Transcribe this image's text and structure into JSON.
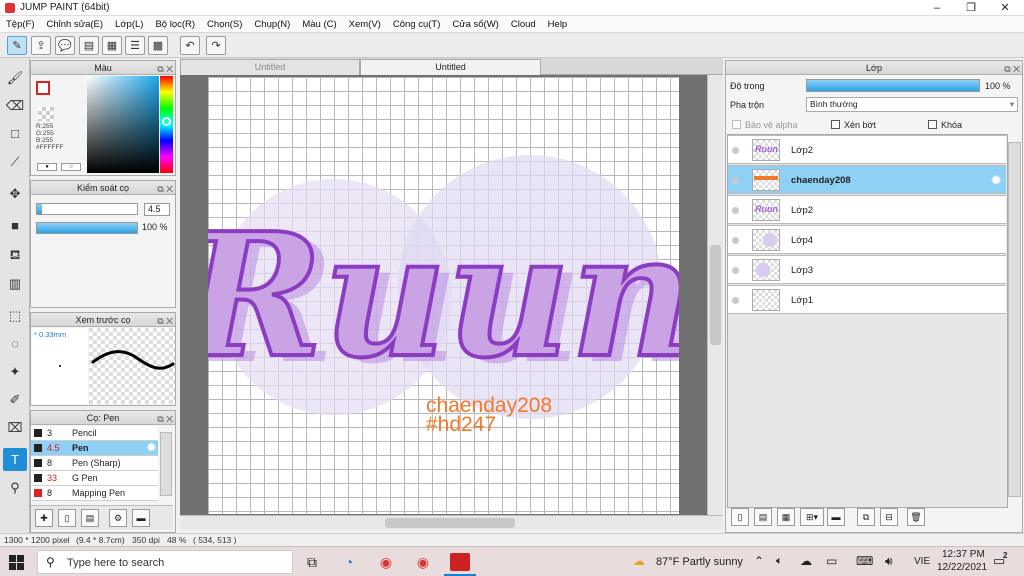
{
  "window": {
    "title": "JUMP PAINT (64bit)",
    "minimize": "–",
    "maximize": "❐",
    "close": "✕"
  },
  "menu": [
    "Tệp(F)",
    "Chỉnh sửa(E)",
    "Lớp(L)",
    "Bộ lọc(R)",
    "Chọn(S)",
    "Chụp(N)",
    "Màu (C)",
    "Xem(V)",
    "Công cụ(T)",
    "Cửa sổ(W)",
    "Cloud",
    "Help"
  ],
  "color_panel": {
    "title": "Màu",
    "r": "R:255",
    "g": "G:255",
    "b": "B:255",
    "hex": "#FFFFFF"
  },
  "brush_control": {
    "title": "Kiểm soát cọ",
    "size": "4.5",
    "opacity": "100 %",
    "size_fraction": 0.05,
    "opacity_fraction": 1.0
  },
  "brush_preview": {
    "title": "Xem trước cọ",
    "size_label": "* 0.33mm"
  },
  "brush_list": {
    "title": "Cọ: Pen",
    "items": [
      {
        "size": "3",
        "name": "Pencil",
        "selected": false
      },
      {
        "size": "4.5",
        "name": "Pen",
        "selected": true
      },
      {
        "size": "8",
        "name": "Pen (Sharp)",
        "selected": false
      },
      {
        "size": "33",
        "name": "G Pen",
        "selected": false
      },
      {
        "size": "8",
        "name": "Mapping Pen",
        "selected": false
      }
    ]
  },
  "tabs": [
    {
      "label": "Untitled",
      "active": false
    },
    {
      "label": "Untitled",
      "active": true
    }
  ],
  "canvas": {
    "art_word": "Ruun",
    "watermark_line1": "chaenday208",
    "watermark_line2": "#hd247",
    "art_color": "#c9a3e3",
    "outline_color": "#8b3cc2",
    "watermark_color": "#f07a2a"
  },
  "layers_panel": {
    "title": "Lớp",
    "opacity_label": "Độ trong",
    "opacity_value": "100 %",
    "opacity_fraction": 1.0,
    "blend_label": "Pha trộn",
    "blend_value": "Bình thường",
    "protect_alpha": "Bảo vệ alpha",
    "clipping": "Xén bớt",
    "lock": "Khóa",
    "layers": [
      {
        "name": "Lớp2",
        "selected": false,
        "thumb": "text"
      },
      {
        "name": "chaenday208",
        "selected": true,
        "thumb": "wm"
      },
      {
        "name": "Lớp2",
        "selected": false,
        "thumb": "text"
      },
      {
        "name": "Lớp4",
        "selected": false,
        "thumb": "circle"
      },
      {
        "name": "Lớp3",
        "selected": false,
        "thumb": "circle"
      },
      {
        "name": "Lớp1",
        "selected": false,
        "thumb": "empty"
      }
    ]
  },
  "statusbar": {
    "size": "1300 * 1200 pixel",
    "dims": "(9.4 * 8.7cm)",
    "dpi": "350 dpi",
    "zoom": "48 %",
    "cursor": "( 534, 513 )"
  },
  "taskbar": {
    "search_placeholder": "Type here to search",
    "weather": "87°F  Partly sunny",
    "lang": "VIE",
    "time": "12:37 PM",
    "date": "12/22/2021",
    "notif_count": "2"
  }
}
